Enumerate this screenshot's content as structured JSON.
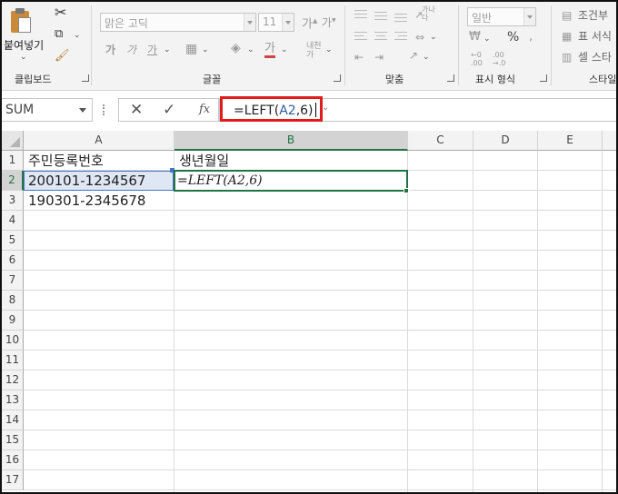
{
  "ribbon": {
    "clipboard": {
      "paste_label": "붙여넣기",
      "group_label": "클립보드"
    },
    "font": {
      "font_name": "맑은 고딕",
      "font_size": "11",
      "group_label": "글꼴"
    },
    "alignment": {
      "wrap_label": "가나 다",
      "group_label": "맞춤"
    },
    "number": {
      "format": "일반",
      "currency": "₩",
      "percent": "%",
      "group_label": "표시 형식"
    },
    "styles": {
      "conditional": "조건부",
      "table_format": "표 서식",
      "cell_styles": "셀 스타",
      "group_label": "스타일"
    }
  },
  "formula_bar": {
    "name_box": "SUM",
    "cancel": "✕",
    "enter": "✓",
    "fx": "fx",
    "formula_prefix": "=LEFT(",
    "formula_ref": "A2",
    "formula_suffix": ",6)"
  },
  "columns": [
    "A",
    "B",
    "C",
    "D",
    "E"
  ],
  "rows": [
    "1",
    "2",
    "3",
    "4",
    "5",
    "6",
    "7",
    "8",
    "9",
    "10",
    "11",
    "12",
    "13",
    "14",
    "15",
    "16",
    "17"
  ],
  "cells": {
    "A1": "주민등록번호",
    "B1": "생년월일",
    "A2": "200101-1234567",
    "B2": "=LEFT(A2,6)",
    "A3": "190301-2345678"
  },
  "colors": {
    "accent_green": "#217346",
    "highlight_red": "#e11b1b",
    "ref_blue": "#4472c4"
  }
}
